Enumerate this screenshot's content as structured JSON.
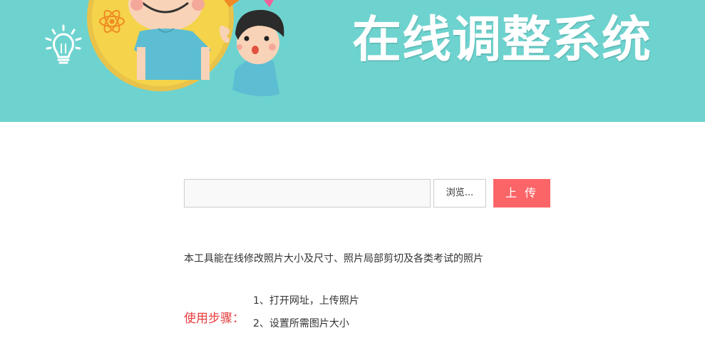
{
  "header": {
    "title": "在线调整系统",
    "colors": {
      "background": "#6ed3cf",
      "circle": "#f5d34b",
      "shirt": "#5cbdd3"
    },
    "icons": [
      "lightbulb-icon",
      "atom-icon"
    ]
  },
  "upload": {
    "file_path_value": "",
    "browse_label": "浏览...",
    "upload_label": "上 传",
    "upload_color": "#fb6568"
  },
  "description": "本工具能在线修改照片大小及尺寸、照片局部剪切及各类考试的照片",
  "steps": {
    "label": "使用步骤：",
    "items": [
      "1、打开网址，上传照片",
      "2、设置所需图片大小"
    ]
  }
}
